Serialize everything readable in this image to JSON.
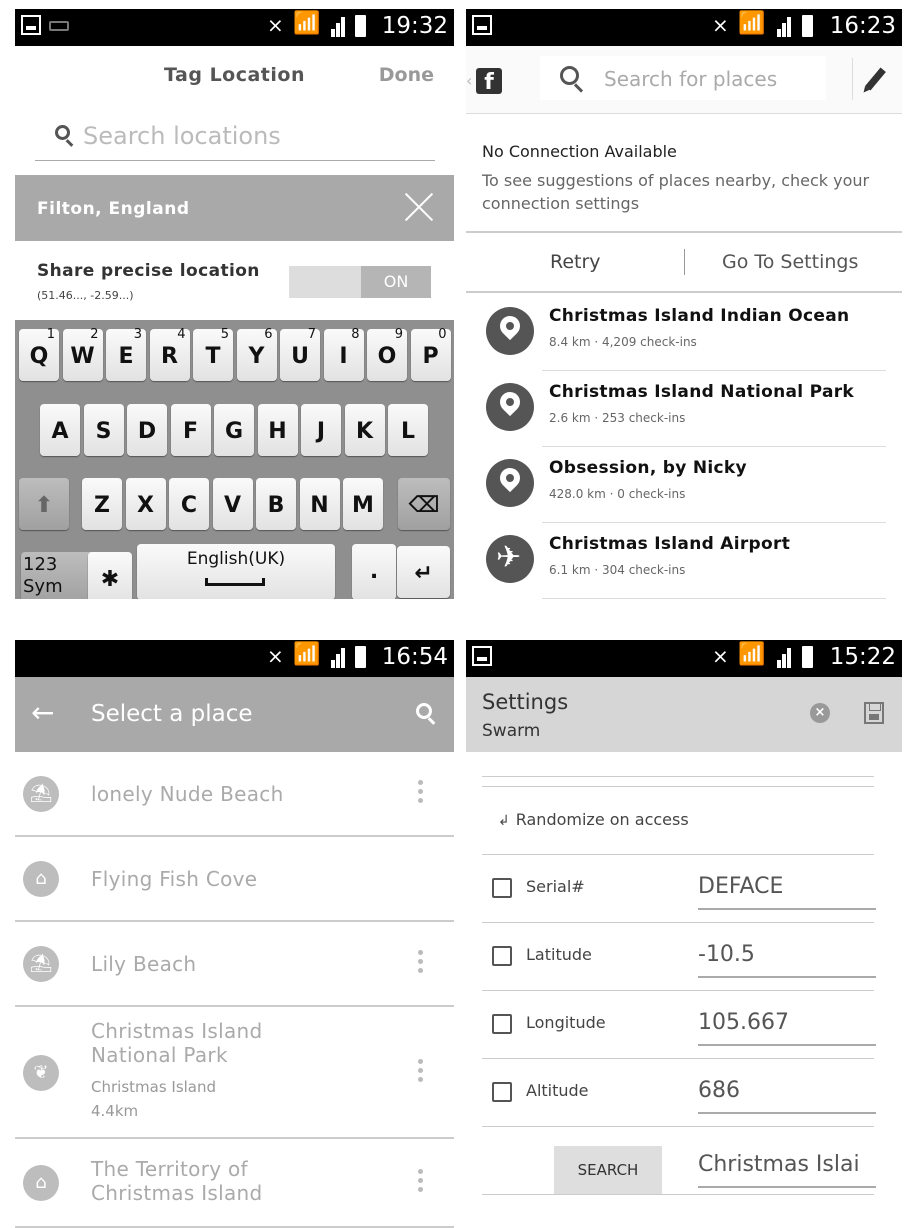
{
  "panel1": {
    "status_time": "19:32",
    "title": "Tag Location",
    "done_label": "Done",
    "search_placeholder": "Search locations",
    "location_label": "Filton, England",
    "share_label": "Share precise location",
    "coords": "(51.46..., -2.59...)",
    "toggle_label": "ON",
    "keyboard": {
      "row1": [
        {
          "key": "Q",
          "sup": "1"
        },
        {
          "key": "W",
          "sup": "2"
        },
        {
          "key": "E",
          "sup": "3"
        },
        {
          "key": "R",
          "sup": "4"
        },
        {
          "key": "T",
          "sup": "5"
        },
        {
          "key": "Y",
          "sup": "6"
        },
        {
          "key": "U",
          "sup": "7"
        },
        {
          "key": "I",
          "sup": "8"
        },
        {
          "key": "O",
          "sup": "9"
        },
        {
          "key": "P",
          "sup": "0"
        }
      ],
      "row2": [
        "A",
        "S",
        "D",
        "F",
        "G",
        "H",
        "J",
        "K",
        "L"
      ],
      "row3": [
        "Z",
        "X",
        "C",
        "V",
        "B",
        "N",
        "M"
      ],
      "sym_line1": "123",
      "sym_line2": "Sym",
      "space_label": "English(UK)",
      "period": "."
    }
  },
  "panel2": {
    "status_time": "16:23",
    "search_placeholder": "Search for places",
    "no_connection_title": "No Connection Available",
    "no_connection_desc": "To see suggestions of places nearby, check your connection settings",
    "retry_label": "Retry",
    "settings_label": "Go To Settings",
    "places": [
      {
        "name": "Christmas Island Indian Ocean",
        "meta": "8.4 km · 4,209 check-ins",
        "icon": "pin-icon"
      },
      {
        "name": "Christmas Island National Park",
        "meta": "2.6 km · 253 check-ins",
        "icon": "pin-icon"
      },
      {
        "name": "Obsession, by Nicky",
        "meta": "428.0 km · 0 check-ins",
        "icon": "pin-icon"
      },
      {
        "name": "Christmas Island Airport",
        "meta": "6.1 km · 304 check-ins",
        "icon": "airplane-icon"
      }
    ]
  },
  "panel3": {
    "status_time": "16:54",
    "title": "Select a place",
    "places": [
      {
        "name": "lonely Nude Beach"
      },
      {
        "name": "Flying Fish Cove"
      },
      {
        "name": "Lily Beach"
      },
      {
        "name": "Christmas Island National Park",
        "sub1": "Christmas Island",
        "sub2": "4.4km"
      },
      {
        "name": "The Territory of Christmas Island"
      }
    ]
  },
  "panel4": {
    "status_time": "15:22",
    "title": "Settings",
    "subtitle": "Swarm",
    "randomize_label": "Randomize on access",
    "fields": [
      {
        "label": "Serial#",
        "value": "DEFACE"
      },
      {
        "label": "Latitude",
        "value": "-10.5"
      },
      {
        "label": "Longitude",
        "value": "105.667"
      },
      {
        "label": "Altitude",
        "value": "686"
      }
    ],
    "search_button": "SEARCH",
    "search_value": "Christmas Islai"
  }
}
